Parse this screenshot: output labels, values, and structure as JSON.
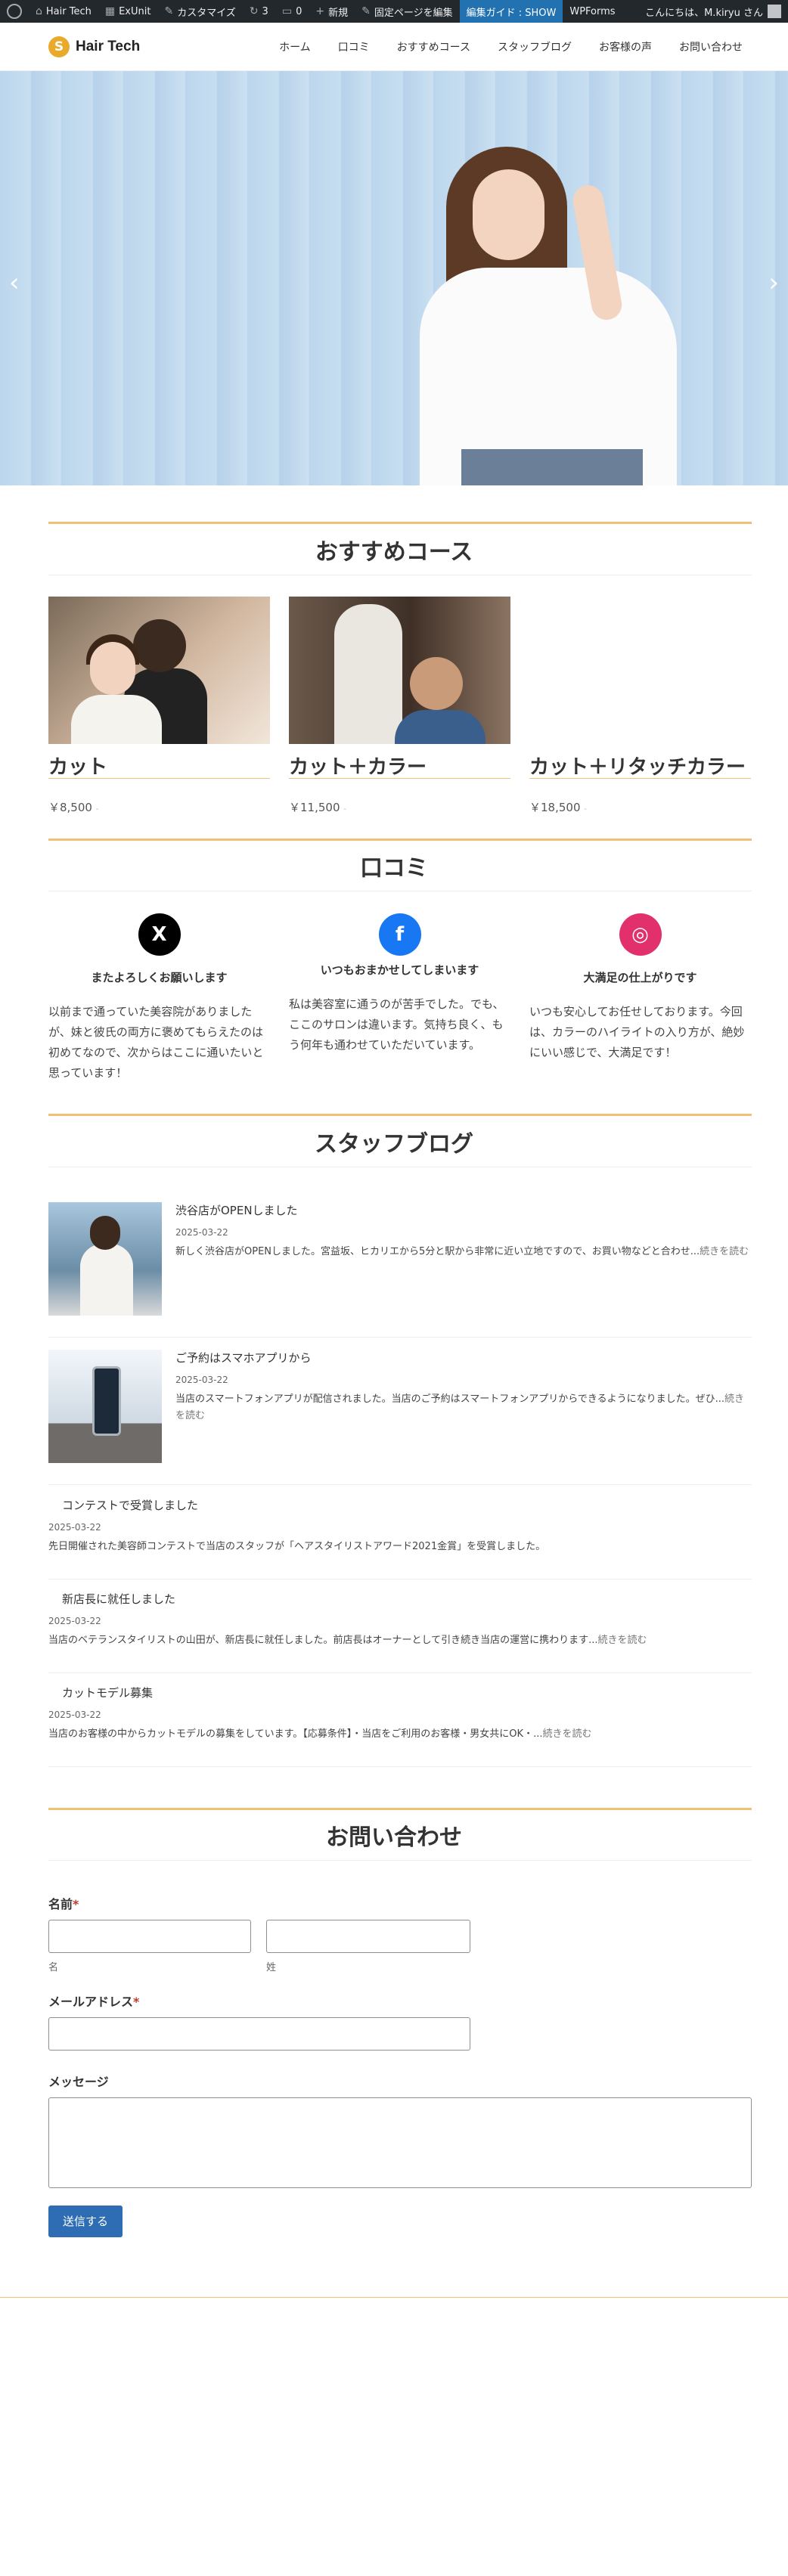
{
  "admin_bar": {
    "site": "Hair Tech",
    "exunit": "ExUnit",
    "customize": "カスタマイズ",
    "updates": "3",
    "comments": "0",
    "new": "新規",
    "edit_page": "固定ページを編集",
    "guide": "編集ガイド : SHOW",
    "wpforms": "WPForms",
    "greeting": "こんにちは、M.kiryu さん"
  },
  "header": {
    "logo_mark": "S",
    "logo_text": "Hair Tech",
    "nav": [
      "ホーム",
      "口コミ",
      "おすすめコース",
      "スタッフブログ",
      "お客様の声",
      "お問い合わせ"
    ]
  },
  "hero": {
    "prev": "‹",
    "next": "›",
    "slide_count": 3,
    "active_slide": 2
  },
  "courses": {
    "title": "おすすめコース",
    "items": [
      {
        "name": "カット",
        "price": "￥8,500",
        "tax": "-"
      },
      {
        "name": "カット＋カラー",
        "price": "￥11,500",
        "tax": "-"
      },
      {
        "name": "カット＋リタッチカラー",
        "price": "￥18,500",
        "tax": "-"
      }
    ]
  },
  "reviews": {
    "title": "口コミ",
    "items": [
      {
        "icon": "X",
        "title": "またよろしくお願いします",
        "body": "以前まで通っていた美容院がありましたが、妹と彼氏の両方に褒めてもらえたのは初めてなので、次からはここに通いたいと思っています！"
      },
      {
        "icon": "f",
        "title": "いつもおまかせしてしまいます",
        "body": "私は美容室に通うのが苦手でした。でも、ここのサロンは違います。気持ち良く、もう何年も通わせていただいています。"
      },
      {
        "icon": "◎",
        "title": "大満足の仕上がりです",
        "body": "いつも安心してお任せしております。今回は、カラーのハイライトの入り方が、絶妙にいい感じで、大満足です！"
      }
    ]
  },
  "blog": {
    "title": "スタッフブログ",
    "posts": [
      {
        "title": "渋谷店がOPENしました",
        "date": "2025-03-22",
        "excerpt": "新しく渋谷店がOPENしました。宮益坂、ヒカリエから5分と駅から非常に近い立地ですので、お買い物などと合わせ...",
        "more": "続きを読む"
      },
      {
        "title": "ご予約はスマホアプリから",
        "date": "2025-03-22",
        "excerpt": "当店のスマートフォンアプリが配信されました。当店のご予約はスマートフォンアプリからできるようになりました。ぜひ...",
        "more": "続きを読む"
      },
      {
        "title": "コンテストで受賞しました",
        "date": "2025-03-22",
        "excerpt": "先日開催された美容師コンテストで当店のスタッフが「ヘアスタイリストアワード2021金賞」を受賞しました。",
        "more": ""
      },
      {
        "title": "新店長に就任しました",
        "date": "2025-03-22",
        "excerpt": "当店のベテランスタイリストの山田が、新店長に就任しました。前店長はオーナーとして引き続き当店の運営に携わります...",
        "more": "続きを読む"
      },
      {
        "title": "カットモデル募集",
        "date": "2025-03-22",
        "excerpt": "当店のお客様の中からカットモデルの募集をしています。【応募条件】・当店をご利用のお客様・男女共にOK・...",
        "more": "続きを読む"
      }
    ]
  },
  "contact": {
    "title": "お問い合わせ",
    "name_label": "名前",
    "required": "*",
    "first_sub": "名",
    "last_sub": "姓",
    "email_label": "メールアドレス",
    "message_label": "メッセージ",
    "submit": "送信する"
  }
}
